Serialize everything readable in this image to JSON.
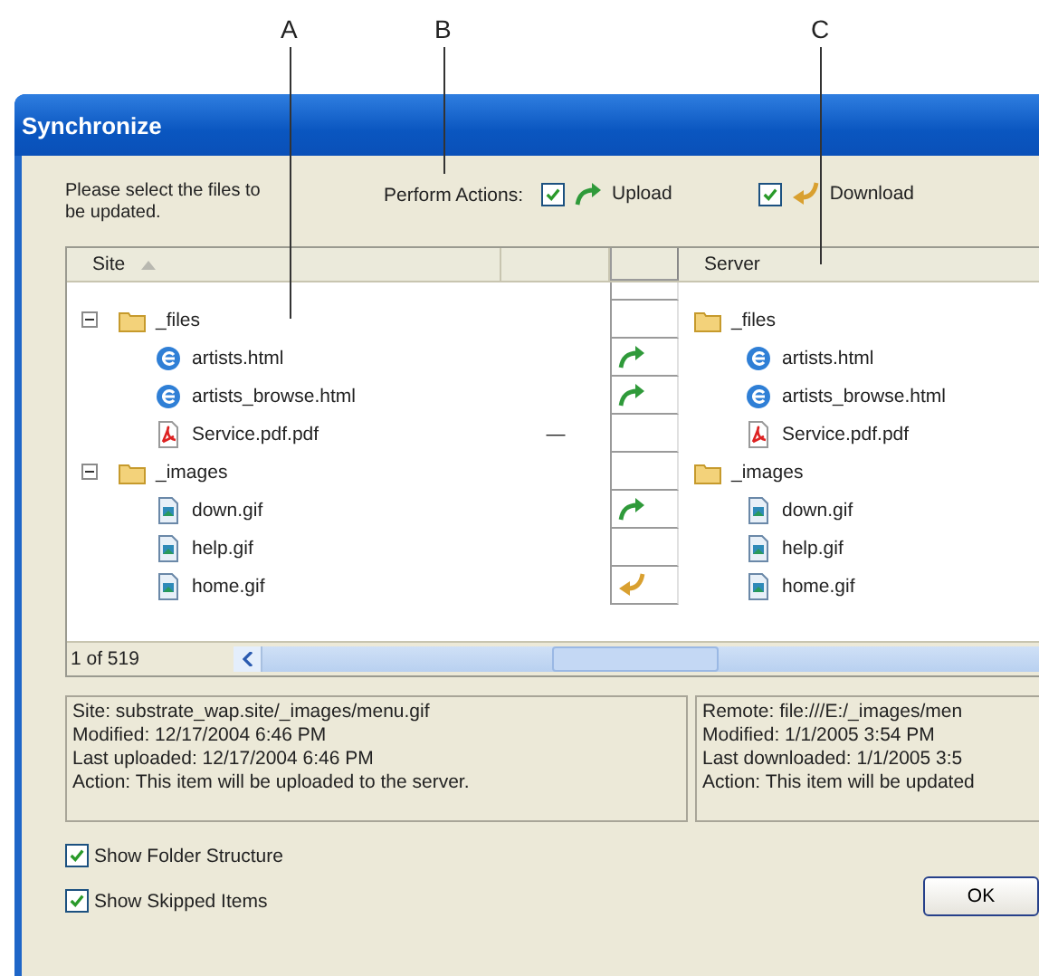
{
  "callouts": [
    {
      "label": "A"
    },
    {
      "label": "B"
    },
    {
      "label": "C"
    }
  ],
  "window": {
    "title": "Synchronize"
  },
  "instructions": "Please select the files to be updated.",
  "perform_actions": {
    "label": "Perform Actions:",
    "options": [
      {
        "kind": "upload",
        "label": "Upload",
        "checked": true
      },
      {
        "kind": "download",
        "label": "Download",
        "checked": true
      }
    ]
  },
  "table": {
    "columns": [
      {
        "label": "Site",
        "sorted": true
      },
      {
        "label": "Server"
      }
    ],
    "rows": [
      {
        "site": {
          "name": "_files",
          "kind": "folder"
        },
        "server": {
          "name": "_files",
          "kind": "folder"
        },
        "expanded": true,
        "upload": false,
        "download": false,
        "children": [
          {
            "site": {
              "name": "artists.html",
              "kind": "html"
            },
            "server": {
              "name": "artists.html",
              "kind": "html"
            },
            "upload": true,
            "download": false
          },
          {
            "site": {
              "name": "artists_browse.html",
              "kind": "html"
            },
            "server": {
              "name": "artists_browse.html",
              "kind": "html"
            },
            "upload": true,
            "download": false
          },
          {
            "site": {
              "name": "Service.pdf.pdf",
              "kind": "pdf"
            },
            "server": {
              "name": "Service.pdf.pdf",
              "kind": "pdf"
            },
            "upload": false,
            "download": false,
            "status": "—"
          }
        ]
      },
      {
        "site": {
          "name": "_images",
          "kind": "folder"
        },
        "server": {
          "name": "_images",
          "kind": "folder"
        },
        "expanded": true,
        "upload": false,
        "download": false,
        "children": [
          {
            "site": {
              "name": "down.gif",
              "kind": "image"
            },
            "server": {
              "name": "down.gif",
              "kind": "image"
            },
            "upload": true,
            "download": false
          },
          {
            "site": {
              "name": "help.gif",
              "kind": "image"
            },
            "server": {
              "name": "help.gif",
              "kind": "image"
            },
            "upload": false,
            "download": false
          },
          {
            "site": {
              "name": "home.gif",
              "kind": "image"
            },
            "server": {
              "name": "home.gif",
              "kind": "image"
            },
            "upload": false,
            "download": true
          }
        ]
      }
    ],
    "status": "1 of 519"
  },
  "site_info": [
    "Site: substrate_wap.site/_images/menu.gif",
    "Modified: 12/17/2004 6:46 PM",
    "Last uploaded: 12/17/2004 6:46 PM",
    "Action: This item will be uploaded to the server."
  ],
  "remote_info": [
    "Remote: file:///E:/_images/men",
    "Modified: 1/1/2005 3:54 PM",
    "Last downloaded: 1/1/2005 3:5",
    "Action: This item will be updated"
  ],
  "options": [
    {
      "label": "Show Folder Structure",
      "checked": true
    },
    {
      "label": "Show Skipped Items",
      "checked": true
    }
  ],
  "buttons": [
    "OK"
  ]
}
